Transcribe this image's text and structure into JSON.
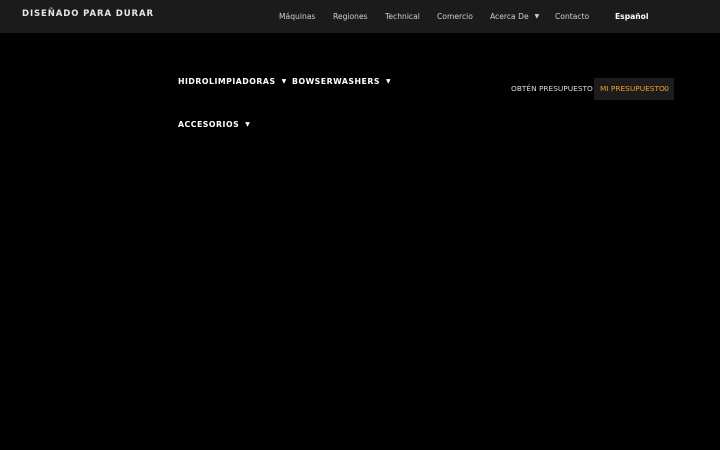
{
  "header": {
    "tagline": "DISEÑADO PARA DURAR",
    "nav": [
      {
        "label": "Máquinas",
        "caret": false
      },
      {
        "label": "Regiones",
        "caret": false
      },
      {
        "label": "Technical",
        "caret": false
      },
      {
        "label": "Comercio",
        "caret": false
      },
      {
        "label": "Acerca De",
        "caret": true
      },
      {
        "label": "Contacto",
        "caret": false
      }
    ],
    "language": "Español",
    "caret_glyph": "▼"
  },
  "main_nav": {
    "items": [
      {
        "label": "HIDROLIMPIADORAS",
        "caret": true
      },
      {
        "label": "BOWSERWASHERS",
        "caret": true
      },
      {
        "label": "ACCESORIOS",
        "caret": true
      }
    ]
  },
  "quote": {
    "link_label": "OBTÉN PRESUPUESTO",
    "my_quote_label": "MI PRESUPUESTO",
    "count": "0"
  },
  "colors": {
    "background": "#000000",
    "topbar": "#1b1b1b",
    "accent": "#f0a030",
    "quote_box": "#1c1c1c"
  }
}
